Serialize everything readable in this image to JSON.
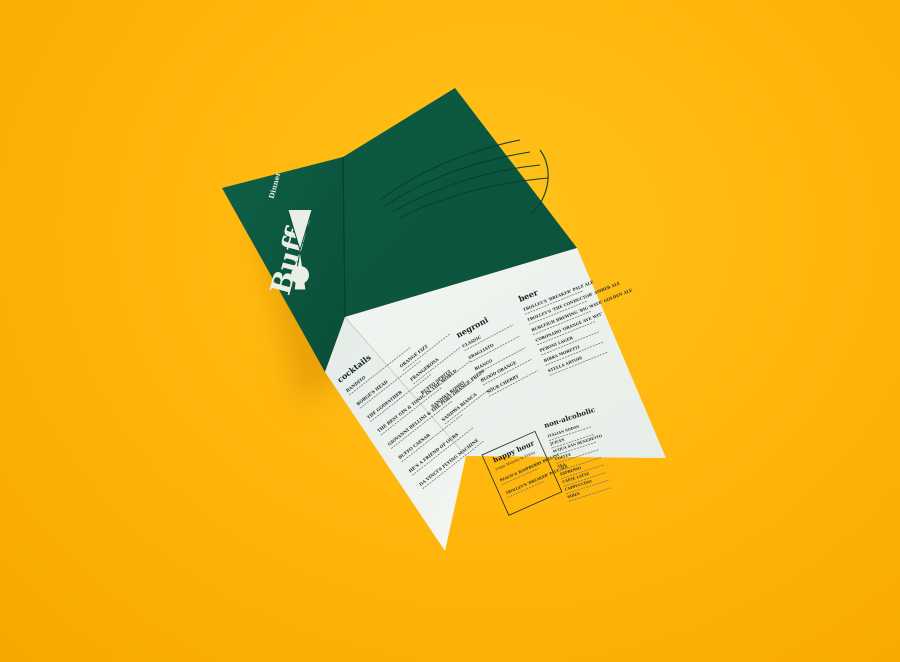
{
  "cover": {
    "logo": "Buffo",
    "tag": "Dinner"
  },
  "sections": {
    "cocktails": {
      "title": "cocktails",
      "items": [
        "BANDITO",
        "BORGE'S HEAD",
        "THE GODFATHER",
        "THE BEST GIN & TONIC IN THE WORLD",
        "GIOVANNI BELLINI & THE PORT ORANGE PRESS",
        "BUFFO CAESAR",
        "HE'S A FRIEND OF OURS",
        "DA VINCI'S FLYING MACHINE"
      ]
    },
    "cocktails_b": {
      "items": [
        "ORANGE FIZZ",
        "FRANGEROSA",
        "BUFFO SPRITZ",
        "SANDWA ROSSO",
        "SANDWA BIANCA"
      ]
    },
    "negroni": {
      "title": "negroni",
      "items": [
        "CLASSIC",
        "SBAGLIATO",
        "BIANCO",
        "BLOOD ORANGE",
        "SOUR CHERRY"
      ]
    },
    "happy_hour": {
      "title": "happy hour",
      "subtitle": "2-6pm Monday to Friday",
      "items": [
        "PEACH & RASPBERRY BELLINI",
        "TROLLEY'S 'BREAKER' PALE ALE"
      ]
    },
    "beer": {
      "title": "beer",
      "items": [
        "TROLLEY'S 'BREAKER' PALE ALE",
        "TROLLEY'S 'THE CONDUCTOR' AMBER ALE",
        "BURLEIGH BREWING 'BIG WAVE' GOLDEN ALE",
        "CORONADO 'ORANGE AVE WIT'",
        "PERONI LAGER",
        "BIRRA MORETTI",
        "STELLA ARTOIS"
      ]
    },
    "non_alcoholic": {
      "title": "non-alcoholic",
      "items": [
        "ITALIAN SODAS",
        "JUICES",
        "ACQUA SAN BENEDETTO",
        "COFFEE",
        "TEA",
        "ESPRESSO",
        "CAFFE LATTE",
        "CAPPUCCINO",
        "SIDES"
      ]
    }
  },
  "colors": {
    "background": "#ffb60d",
    "cover_green": "#0d5a41",
    "paper": "#eef3ee",
    "ink": "#1f2b25"
  }
}
